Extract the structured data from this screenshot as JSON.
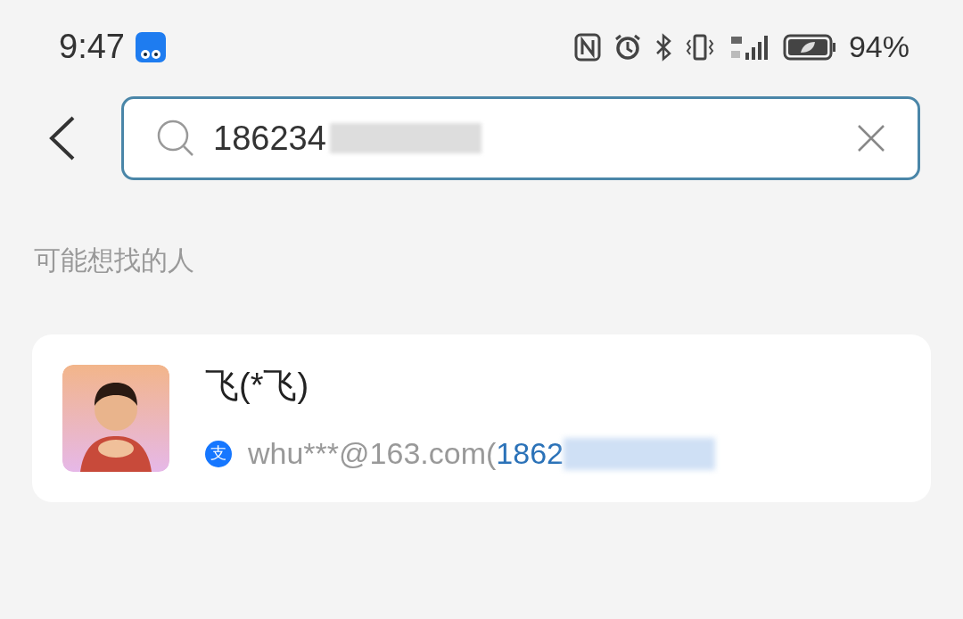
{
  "status_bar": {
    "time": "9:47",
    "battery": "94%"
  },
  "search": {
    "value": "186234"
  },
  "section_title": "可能想找的人",
  "results": [
    {
      "name": "飞(*飞)",
      "source_glyph": "支",
      "account": "whu***@163.com(",
      "phone": "1862"
    }
  ]
}
